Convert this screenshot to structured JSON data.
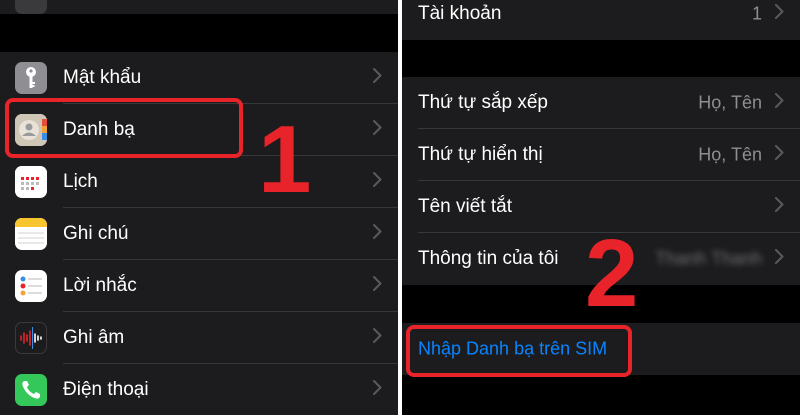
{
  "left": {
    "items": [
      {
        "label": "Mật khẩu",
        "icon": "key-icon"
      },
      {
        "label": "Danh bạ",
        "icon": "contacts-icon"
      },
      {
        "label": "Lịch",
        "icon": "calendar-icon"
      },
      {
        "label": "Ghi chú",
        "icon": "notes-icon"
      },
      {
        "label": "Lời nhắc",
        "icon": "reminders-icon"
      },
      {
        "label": "Ghi âm",
        "icon": "voice-memos-icon"
      },
      {
        "label": "Điện thoại",
        "icon": "phone-icon"
      }
    ]
  },
  "right": {
    "accounts": {
      "label": "Tài khoản",
      "value": "1"
    },
    "sort_order": {
      "label": "Thứ tự sắp xếp",
      "value": "Họ, Tên"
    },
    "display_order": {
      "label": "Thứ tự hiển thị",
      "value": "Họ, Tên"
    },
    "short_name": {
      "label": "Tên viết tắt"
    },
    "my_info": {
      "label": "Thông tin của tôi",
      "value": "Thanh Thanh"
    },
    "import_sim": {
      "label": "Nhập Danh bạ trên SIM"
    }
  },
  "annotations": {
    "step1": "1",
    "step2": "2"
  },
  "colors": {
    "accent_blue": "#0a84ff",
    "annotation_red": "#e8232a",
    "cell_bg": "#1c1c1e"
  }
}
